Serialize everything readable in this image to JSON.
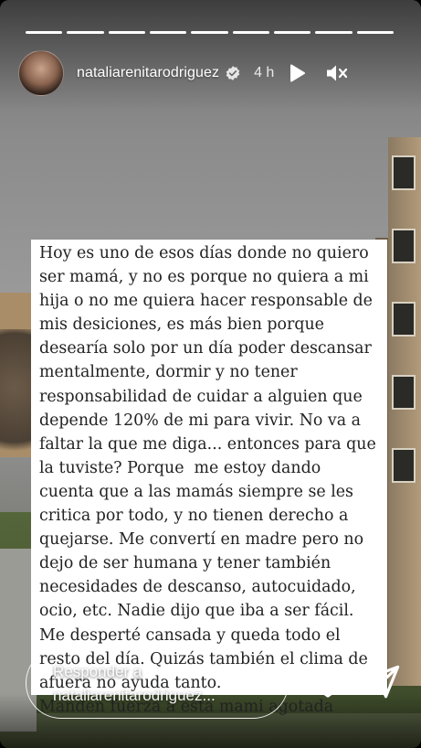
{
  "progress": {
    "segments": 9,
    "completed": 9
  },
  "header": {
    "username": "natalia​renitarodriguez",
    "time": "4 h"
  },
  "story_text": {
    "lines": [
      "Hoy es uno de esos días donde no quiero",
      "ser mamá, y no es porque no quiera a mi",
      "hija o no me quiera hacer responsable de",
      "mis desiciones, es más bien porque",
      "desearía solo por un día poder descansar",
      "mentalmente, dormir y no tener",
      "responsabilidad de cuidar a alguien que",
      "depende 120% de mi para vivir. No va a",
      "faltar la que me diga... entonces para que",
      "la tuviste? Porque  me estoy dando",
      "cuenta que a las mamás siempre se les",
      "critica por todo, y no tienen derecho a",
      "quejarse. Me convertí en madre pero no",
      "dejo de ser humana y tener también",
      "necesidades de descanso, autocuidado,",
      "ocio, etc. Nadie dijo que iba a ser fácil.",
      "Me desperté cansada y queda todo el",
      "resto del día. Quizás también el clima de",
      "afuera no ayuda tanto.",
      "Manden fuerza a esta mami agotada"
    ]
  },
  "reply": {
    "line1": "Responder a",
    "line2": "nataliarenitarodriguez..."
  },
  "icons": {
    "verified": "verified-badge-icon",
    "play": "play-icon",
    "mute": "mute-icon",
    "like": "heart-icon",
    "share": "send-icon"
  }
}
